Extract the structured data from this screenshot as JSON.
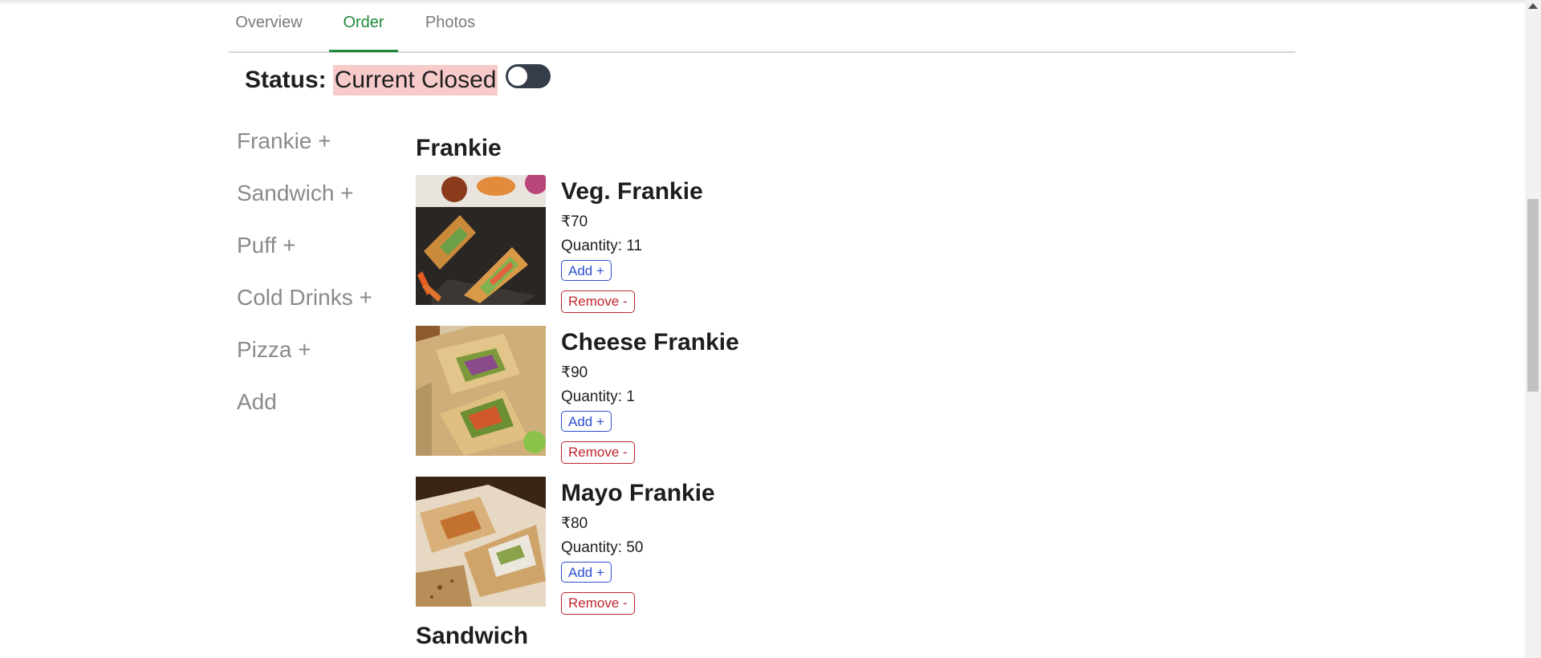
{
  "tabs": [
    {
      "label": "Overview",
      "active": false
    },
    {
      "label": "Order",
      "active": true
    },
    {
      "label": "Photos",
      "active": false
    }
  ],
  "status": {
    "label": "Status:",
    "value": "Current Closed",
    "toggle_on": false
  },
  "sidebar": {
    "items": [
      {
        "label": "Frankie +"
      },
      {
        "label": "Sandwich +"
      },
      {
        "label": "Puff +"
      },
      {
        "label": "Cold Drinks +"
      },
      {
        "label": "Pizza +"
      },
      {
        "label": "Add"
      }
    ]
  },
  "menu": {
    "category": "Frankie",
    "items": [
      {
        "name": "Veg. Frankie",
        "price": "₹70",
        "quantity": "Quantity: 11",
        "add_label": "Add +",
        "remove_label": "Remove -"
      },
      {
        "name": "Cheese Frankie",
        "price": "₹90",
        "quantity": "Quantity: 1",
        "add_label": "Add +",
        "remove_label": "Remove -"
      },
      {
        "name": "Mayo Frankie",
        "price": "₹80",
        "quantity": "Quantity: 50",
        "add_label": "Add +",
        "remove_label": "Remove -"
      }
    ],
    "next_category": "Sandwich"
  },
  "colors": {
    "accent": "#1f8a3a",
    "closed_highlight": "#f8cbcb",
    "add_button": "#2d4fd0",
    "remove_button": "#c0262d"
  }
}
